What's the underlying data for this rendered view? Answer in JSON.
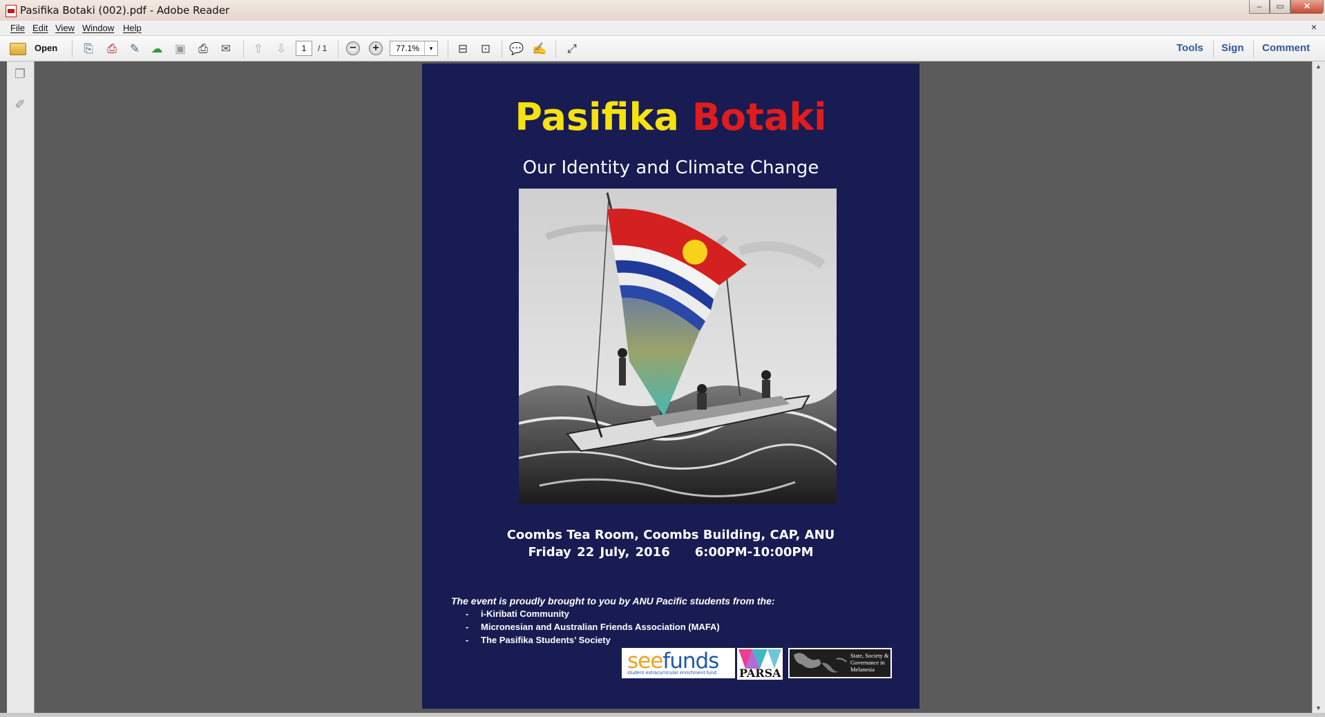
{
  "window": {
    "title": "Pasifika Botaki (002).pdf - Adobe Reader",
    "controls": [
      "minimize",
      "maximize",
      "close"
    ]
  },
  "menu": {
    "items": [
      "File",
      "Edit",
      "View",
      "Window",
      "Help"
    ],
    "close_doc": "×"
  },
  "toolbar": {
    "open_label": "Open",
    "page_current": "1",
    "page_total": "/ 1",
    "zoom_value": "77.1%",
    "zoom_dropdown_glyph": "▾",
    "right_tabs": [
      "Tools",
      "Sign",
      "Comment"
    ]
  },
  "document": {
    "title_part1": "Pasifika",
    "title_part2": "Botaki",
    "subtitle": "Our Identity and Climate Change",
    "venue": "Coombs Tea Room, Coombs Building, CAP, ANU",
    "date": "Friday 22 July, 2016",
    "time": "6:00PM-10:00PM",
    "intro": "The event is proudly brought to you by ANU Pacific students from the:",
    "organizations": [
      "i-Kiribati Community",
      "Micronesian and Australian Friends Association (MAFA)",
      "The Pasifika Students’ Society"
    ],
    "sponsor_logos": {
      "seefunds_a": "see",
      "seefunds_b": "funds",
      "seefunds_tagline": "student extracurricular enrichment fund",
      "parsa": "PARSA",
      "sscgm": "State, Society & Governance in Melanesia"
    }
  },
  "colors": {
    "page_background": "#181c52",
    "title_yellow": "#f6e20f",
    "title_red": "#e01c1c",
    "workspace": "#5b5b5b",
    "link_blue": "#2a5aa0"
  }
}
